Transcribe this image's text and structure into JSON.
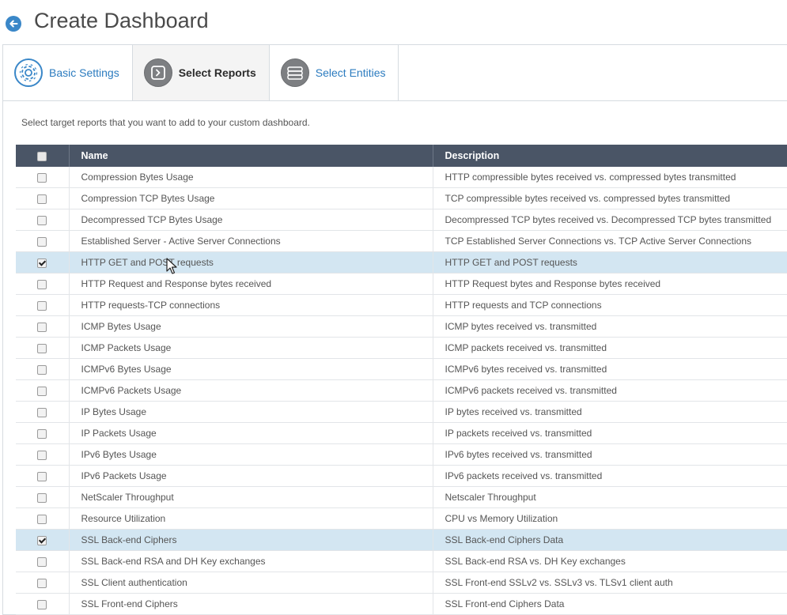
{
  "header": {
    "title": "Create Dashboard"
  },
  "tabs": [
    {
      "label": "Basic Settings",
      "icon": "gear-icon",
      "active": false
    },
    {
      "label": "Select Reports",
      "icon": "report-icon",
      "active": true
    },
    {
      "label": "Select Entities",
      "icon": "server-icon",
      "active": false
    }
  ],
  "instruction": "Select target reports that you want to add to your custom dashboard.",
  "table": {
    "columns": [
      "Name",
      "Description"
    ],
    "rows": [
      {
        "name": "Compression Bytes Usage",
        "description": "HTTP compressible bytes received vs. compressed bytes transmitted",
        "checked": false
      },
      {
        "name": "Compression TCP Bytes Usage",
        "description": "TCP compressible bytes received vs. compressed bytes transmitted",
        "checked": false
      },
      {
        "name": "Decompressed TCP Bytes Usage",
        "description": "Decompressed TCP bytes received vs. Decompressed TCP bytes transmitted",
        "checked": false
      },
      {
        "name": "Established Server - Active Server Connections",
        "description": "TCP Established Server Connections vs. TCP Active Server Connections",
        "checked": false
      },
      {
        "name": "HTTP GET and POST requests",
        "description": "HTTP GET and POST requests",
        "checked": true
      },
      {
        "name": "HTTP Request and Response bytes received",
        "description": "HTTP Request bytes and Response bytes received",
        "checked": false
      },
      {
        "name": "HTTP requests-TCP connections",
        "description": "HTTP requests and TCP connections",
        "checked": false
      },
      {
        "name": "ICMP Bytes Usage",
        "description": "ICMP bytes received vs. transmitted",
        "checked": false
      },
      {
        "name": "ICMP Packets Usage",
        "description": "ICMP packets received vs. transmitted",
        "checked": false
      },
      {
        "name": "ICMPv6 Bytes Usage",
        "description": " ICMPv6 bytes received vs. transmitted",
        "checked": false
      },
      {
        "name": "ICMPv6 Packets Usage",
        "description": " ICMPv6 packets received vs. transmitted",
        "checked": false
      },
      {
        "name": "IP Bytes Usage",
        "description": "IP bytes received vs. transmitted",
        "checked": false
      },
      {
        "name": "IP Packets Usage",
        "description": "IP packets received vs. transmitted",
        "checked": false
      },
      {
        "name": "IPv6 Bytes Usage",
        "description": "IPv6 bytes received vs. transmitted",
        "checked": false
      },
      {
        "name": "IPv6 Packets Usage",
        "description": "IPv6 packets received vs. transmitted",
        "checked": false
      },
      {
        "name": "NetScaler Throughput",
        "description": "Netscaler Throughput",
        "checked": false
      },
      {
        "name": "Resource Utilization",
        "description": "CPU vs Memory Utilization",
        "checked": false
      },
      {
        "name": "SSL Back-end Ciphers",
        "description": "SSL Back-end Ciphers Data",
        "checked": true
      },
      {
        "name": "SSL Back-end RSA and DH Key exchanges",
        "description": "SSL Back-end RSA vs. DH Key exchanges",
        "checked": false
      },
      {
        "name": "SSL Client authentication",
        "description": "SSL Front-end SSLv2 vs. SSLv3 vs. TLSv1 client auth",
        "checked": false
      },
      {
        "name": "SSL Front-end Ciphers",
        "description": "SSL Front-end Ciphers Data",
        "checked": false
      }
    ]
  },
  "colors": {
    "accent": "#3a87c8",
    "header_bg": "#4a5566",
    "selected_row": "#d3e6f2"
  }
}
